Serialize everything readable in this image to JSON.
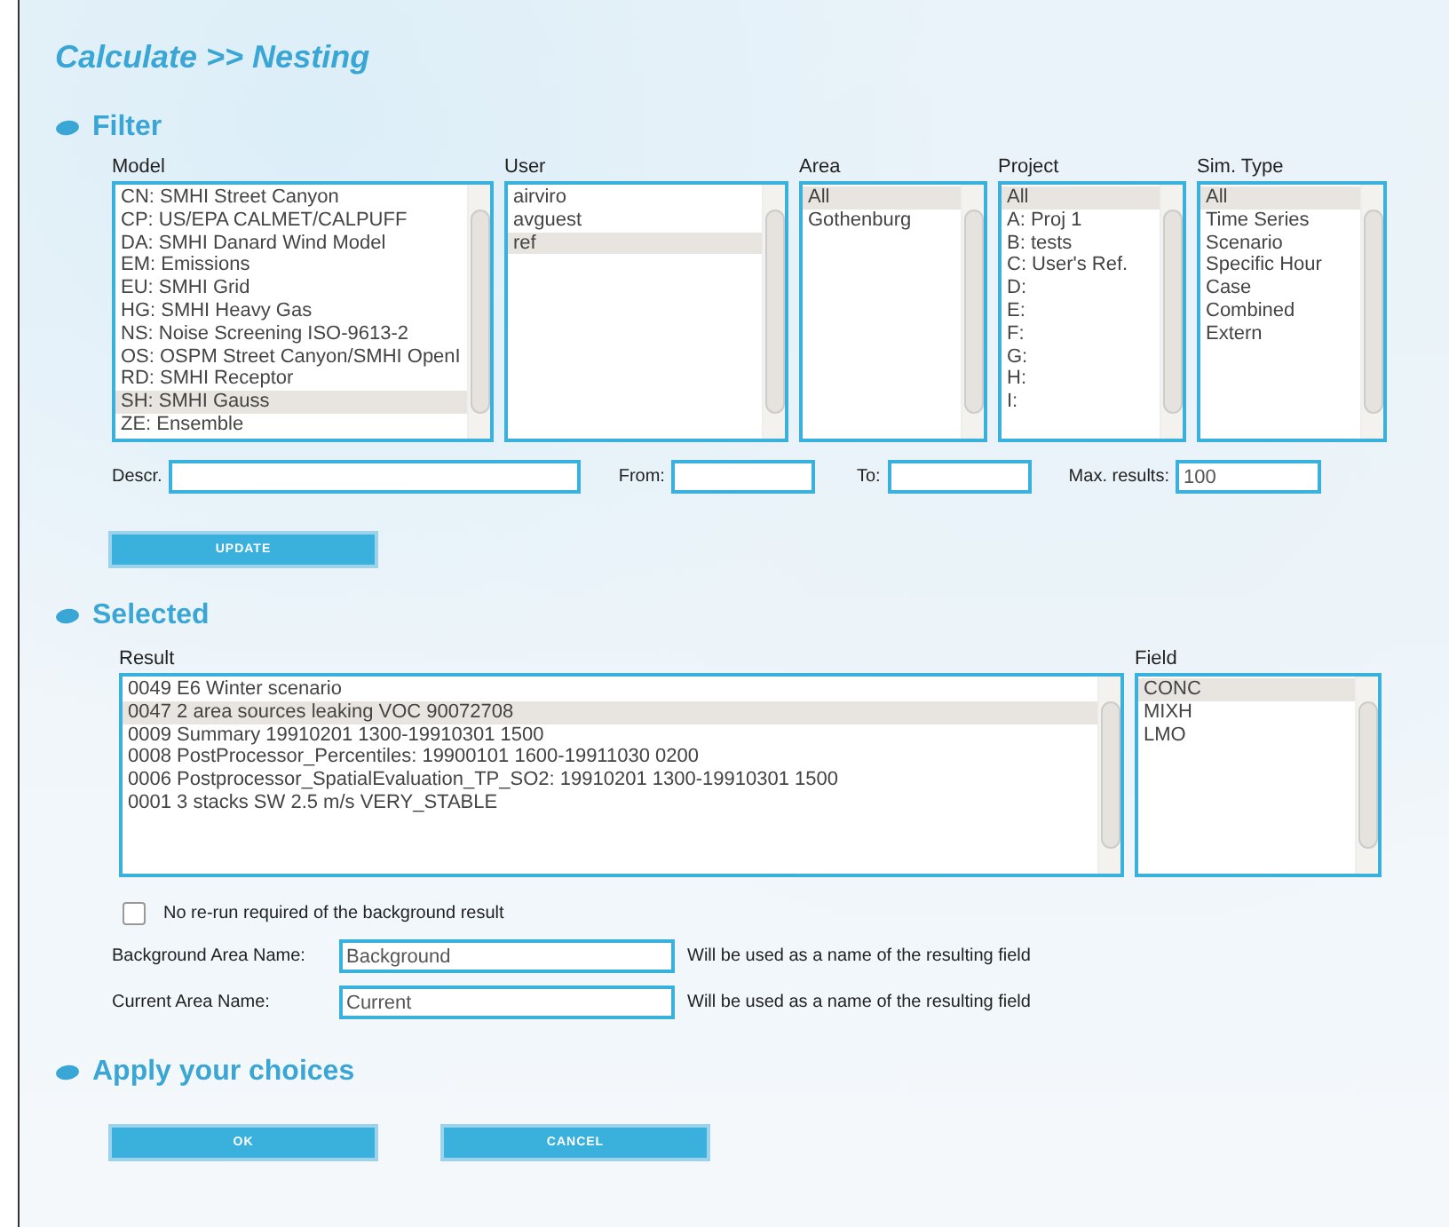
{
  "title": "Calculate >> Nesting",
  "filter": {
    "heading": "Filter",
    "lists": [
      {
        "label": "Model",
        "items": [
          {
            "text": "CN: SMHI Street Canyon",
            "selected": false
          },
          {
            "text": "CP: US/EPA CALMET/CALPUFF",
            "selected": false
          },
          {
            "text": "DA: SMHI Danard Wind Model",
            "selected": false
          },
          {
            "text": "EM: Emissions",
            "selected": false
          },
          {
            "text": "EU: SMHI Grid",
            "selected": false
          },
          {
            "text": "HG: SMHI Heavy Gas",
            "selected": false
          },
          {
            "text": "NS: Noise Screening ISO-9613-2",
            "selected": false
          },
          {
            "text": "OS: OSPM Street Canyon/SMHI OpenI",
            "selected": false
          },
          {
            "text": "RD: SMHI Receptor",
            "selected": false
          },
          {
            "text": "SH: SMHI Gauss",
            "selected": true
          },
          {
            "text": "ZE: Ensemble",
            "selected": false
          }
        ]
      },
      {
        "label": "User",
        "items": [
          {
            "text": "airviro",
            "selected": false
          },
          {
            "text": "avguest",
            "selected": false
          },
          {
            "text": "ref",
            "selected": true
          }
        ]
      },
      {
        "label": "Area",
        "items": [
          {
            "text": "All",
            "selected": true
          },
          {
            "text": "Gothenburg",
            "selected": false
          }
        ]
      },
      {
        "label": "Project",
        "items": [
          {
            "text": "All",
            "selected": true
          },
          {
            "text": "A: Proj 1",
            "selected": false
          },
          {
            "text": "B: tests",
            "selected": false
          },
          {
            "text": "C: User's Ref.",
            "selected": false
          },
          {
            "text": "D:",
            "selected": false
          },
          {
            "text": "E:",
            "selected": false
          },
          {
            "text": "F:",
            "selected": false
          },
          {
            "text": "G:",
            "selected": false
          },
          {
            "text": "H:",
            "selected": false
          },
          {
            "text": "I:",
            "selected": false
          }
        ]
      },
      {
        "label": "Sim. Type",
        "items": [
          {
            "text": "All",
            "selected": true
          },
          {
            "text": "Time Series",
            "selected": false
          },
          {
            "text": "Scenario",
            "selected": false
          },
          {
            "text": "Specific Hour",
            "selected": false
          },
          {
            "text": "Case",
            "selected": false
          },
          {
            "text": "Combined",
            "selected": false
          },
          {
            "text": "Extern",
            "selected": false
          }
        ]
      }
    ],
    "fields": [
      {
        "label": "Descr."
      },
      {
        "label": "From:"
      },
      {
        "label": "To:"
      },
      {
        "label": "Max. results:",
        "value": "100"
      }
    ],
    "update_button": "UPDATE"
  },
  "selected": {
    "heading": "Selected",
    "result": {
      "label": "Result",
      "items": [
        {
          "text": "0049 E6 Winter scenario",
          "selected": false
        },
        {
          "text": "0047 2 area sources leaking VOC 90072708",
          "selected": true
        },
        {
          "text": "0009 Summary 19910201 1300-19910301 1500",
          "selected": false
        },
        {
          "text": "0008 PostProcessor_Percentiles: 19900101 1600-19911030 0200",
          "selected": false
        },
        {
          "text": "0006 Postprocessor_SpatialEvaluation_TP_SO2: 19910201 1300-19910301 1500",
          "selected": false
        },
        {
          "text": "0001 3 stacks SW 2.5 m/s VERY_STABLE",
          "selected": false
        }
      ]
    },
    "field": {
      "label": "Field",
      "items": [
        {
          "text": "CONC",
          "selected": true
        },
        {
          "text": "MIXH",
          "selected": false
        },
        {
          "text": "LMO",
          "selected": false
        }
      ]
    },
    "no_rerun": {
      "label": "No re-run required of the background result",
      "checked": false
    },
    "names": [
      {
        "label": "Background Area Name:",
        "value": "Background",
        "note": "Will be used as a name of the resulting field"
      },
      {
        "label": "Current Area Name:",
        "value": "Current",
        "note": "Will be used as a name of the resulting field"
      }
    ]
  },
  "apply": {
    "heading": "Apply your choices",
    "buttons": [
      "OK",
      "CANCEL"
    ]
  }
}
